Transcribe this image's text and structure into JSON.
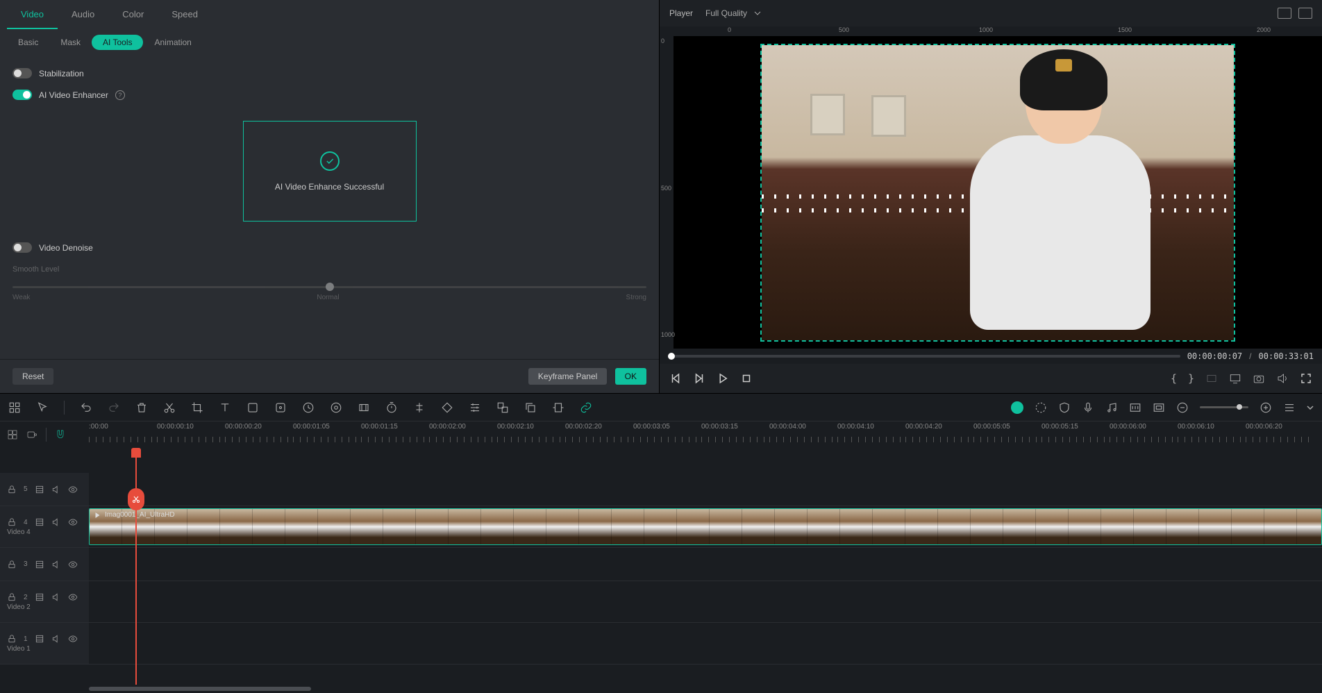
{
  "mainTabs": [
    "Video",
    "Audio",
    "Color",
    "Speed"
  ],
  "mainTabActive": 0,
  "subTabs": [
    "Basic",
    "Mask",
    "AI Tools",
    "Animation"
  ],
  "subTabActive": 2,
  "toggles": {
    "stabilization": {
      "label": "Stabilization",
      "on": false
    },
    "enhancer": {
      "label": "AI Video Enhancer",
      "on": true
    },
    "denoise": {
      "label": "Video Denoise",
      "on": false
    }
  },
  "enhanceStatus": "AI Video Enhance Successful",
  "smooth": {
    "label": "Smooth Level",
    "weak": "Weak",
    "normal": "Normal",
    "strong": "Strong"
  },
  "footer": {
    "reset": "Reset",
    "keyframe": "Keyframe Panel",
    "ok": "OK"
  },
  "player": {
    "label": "Player",
    "quality": "Full Quality"
  },
  "rulerTop": [
    {
      "v": "0",
      "p": 98
    },
    {
      "v": "500",
      "p": 258
    },
    {
      "v": "1000",
      "p": 460
    },
    {
      "v": "1500",
      "p": 660
    },
    {
      "v": "2000",
      "p": 860
    }
  ],
  "rulerLeft": [
    {
      "v": "0",
      "p": 2
    },
    {
      "v": "500",
      "p": 214
    },
    {
      "v": "1000",
      "p": 425
    }
  ],
  "time": {
    "current": "00:00:00:07",
    "total": "00:00:33:01",
    "sep": "/"
  },
  "timeTicks": [
    ":00:00",
    "00:00:00:10",
    "00:00:00:20",
    "00:00:01:05",
    "00:00:01:15",
    "00:00:02:00",
    "00:00:02:10",
    "00:00:02:20",
    "00:00:03:05",
    "00:00:03:15",
    "00:00:04:00",
    "00:00:04:10",
    "00:00:04:20",
    "00:00:05:05",
    "00:00:05:15",
    "00:00:06:00",
    "00:00:06:10",
    "00:00:06:20"
  ],
  "tracks": [
    {
      "num": "5"
    },
    {
      "num": "4",
      "label": "Video 4",
      "clip": "Imag0001_AI_UltraHD"
    },
    {
      "num": "3"
    },
    {
      "num": "2",
      "label": "Video 2"
    },
    {
      "num": "1",
      "label": "Video 1"
    }
  ]
}
